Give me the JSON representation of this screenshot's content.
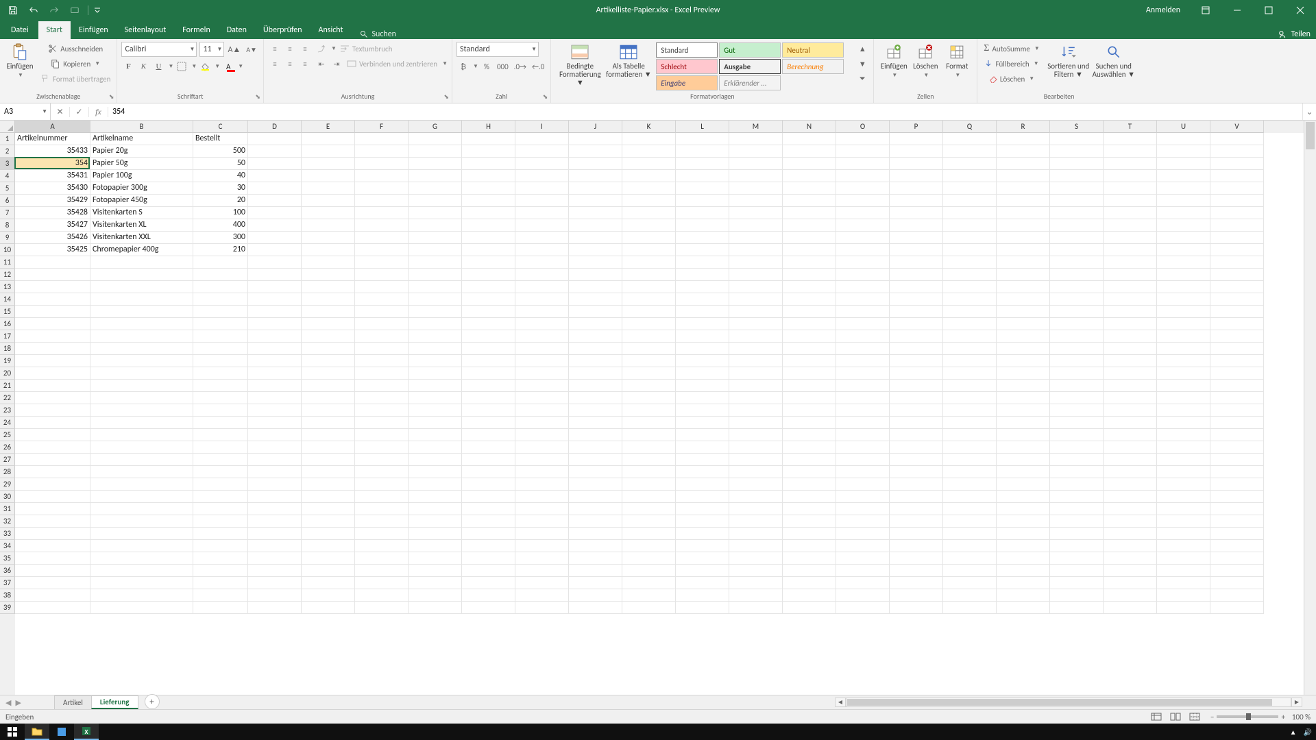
{
  "title": "Artikelliste-Papier.xlsx - Excel Preview",
  "titlebar": {
    "signin": "Anmelden"
  },
  "tabs": {
    "file": "Datei",
    "home": "Start",
    "insert": "Einfügen",
    "page_layout": "Seitenlayout",
    "formulas": "Formeln",
    "data": "Daten",
    "review": "Überprüfen",
    "view": "Ansicht",
    "search": "Suchen",
    "share": "Teilen"
  },
  "ribbon": {
    "clipboard": {
      "paste": "Einfügen",
      "cut": "Ausschneiden",
      "copy": "Kopieren",
      "format_painter": "Format übertragen",
      "title": "Zwischenablage"
    },
    "font": {
      "name": "Calibri",
      "size": "11",
      "title": "Schriftart"
    },
    "alignment": {
      "wrap": "Textumbruch",
      "merge": "Verbinden und zentrieren",
      "title": "Ausrichtung"
    },
    "number": {
      "format": "Standard",
      "title": "Zahl"
    },
    "styles": {
      "cond_format": "Bedingte",
      "cond_format2": "Formatierung",
      "as_table": "Als Tabelle",
      "as_table2": "formatieren",
      "standard": "Standard",
      "gut": "Gut",
      "neutral": "Neutral",
      "schlecht": "Schlecht",
      "ausgabe": "Ausgabe",
      "berechnung": "Berechnung",
      "eingabe": "Eingabe",
      "erklarender": "Erklärender ...",
      "title": "Formatvorlagen"
    },
    "cells": {
      "insert": "Einfügen",
      "delete": "Löschen",
      "format": "Format",
      "title": "Zellen"
    },
    "editing": {
      "autosum": "AutoSumme",
      "fill": "Füllbereich",
      "clear": "Löschen",
      "sort": "Sortieren und",
      "sort2": "Filtern",
      "find": "Suchen und",
      "find2": "Auswählen",
      "title": "Bearbeiten"
    }
  },
  "namebox": "A3",
  "formula": "354",
  "columns": [
    "A",
    "B",
    "C",
    "D",
    "E",
    "F",
    "G",
    "H",
    "I",
    "J",
    "K",
    "L",
    "M",
    "N",
    "O",
    "P",
    "Q",
    "R",
    "S",
    "T",
    "U",
    "V"
  ],
  "col_widths": {
    "A": 110,
    "B": 150,
    "C": 80,
    "default": 78
  },
  "rows": [
    {
      "n": 1,
      "A": "Artikelnummer",
      "B": "Artikelname",
      "C": "Bestellt",
      "header": true
    },
    {
      "n": 2,
      "A": "35433",
      "B": "Papier 20g",
      "C": "500"
    },
    {
      "n": 3,
      "A": "354",
      "B": "Papier 50g",
      "C": "50",
      "selected": true
    },
    {
      "n": 4,
      "A": "35431",
      "B": "Papier 100g",
      "C": "40"
    },
    {
      "n": 5,
      "A": "35430",
      "B": "Fotopapier 300g",
      "C": "30"
    },
    {
      "n": 6,
      "A": "35429",
      "B": "Fotopapier 450g",
      "C": "20"
    },
    {
      "n": 7,
      "A": "35428",
      "B": "Visitenkarten S",
      "C": "100"
    },
    {
      "n": 8,
      "A": "35427",
      "B": "Visitenkarten XL",
      "C": "400"
    },
    {
      "n": 9,
      "A": "35426",
      "B": "Visitenkarten XXL",
      "C": "300"
    },
    {
      "n": 10,
      "A": "35425",
      "B": "Chromepapier 400g",
      "C": "210"
    }
  ],
  "total_visible_rows": 39,
  "sheets": {
    "tab1": "Artikel",
    "tab2": "Lieferung"
  },
  "status": {
    "mode": "Eingeben",
    "zoom": "100 %"
  },
  "selection": {
    "col": "A",
    "row": 3
  },
  "style_colors": {
    "standard_bg": "#ffffff",
    "standard_border": "#b7b7b7",
    "gut_bg": "#c6efce",
    "gut_fg": "#006100",
    "neutral_bg": "#ffeb9c",
    "neutral_fg": "#9c5700",
    "schlecht_bg": "#ffc7ce",
    "schlecht_fg": "#9c0006",
    "ausgabe_bg": "#f2f2f2",
    "ausgabe_fg": "#3f3f3f",
    "ausgabe_border": "#808080",
    "berechnung_bg": "#f2f2f2",
    "berechnung_fg": "#fa7d00",
    "eingabe_bg": "#ffcc99",
    "eingabe_fg": "#3f3f76",
    "erkl_fg": "#7f7f7f"
  }
}
